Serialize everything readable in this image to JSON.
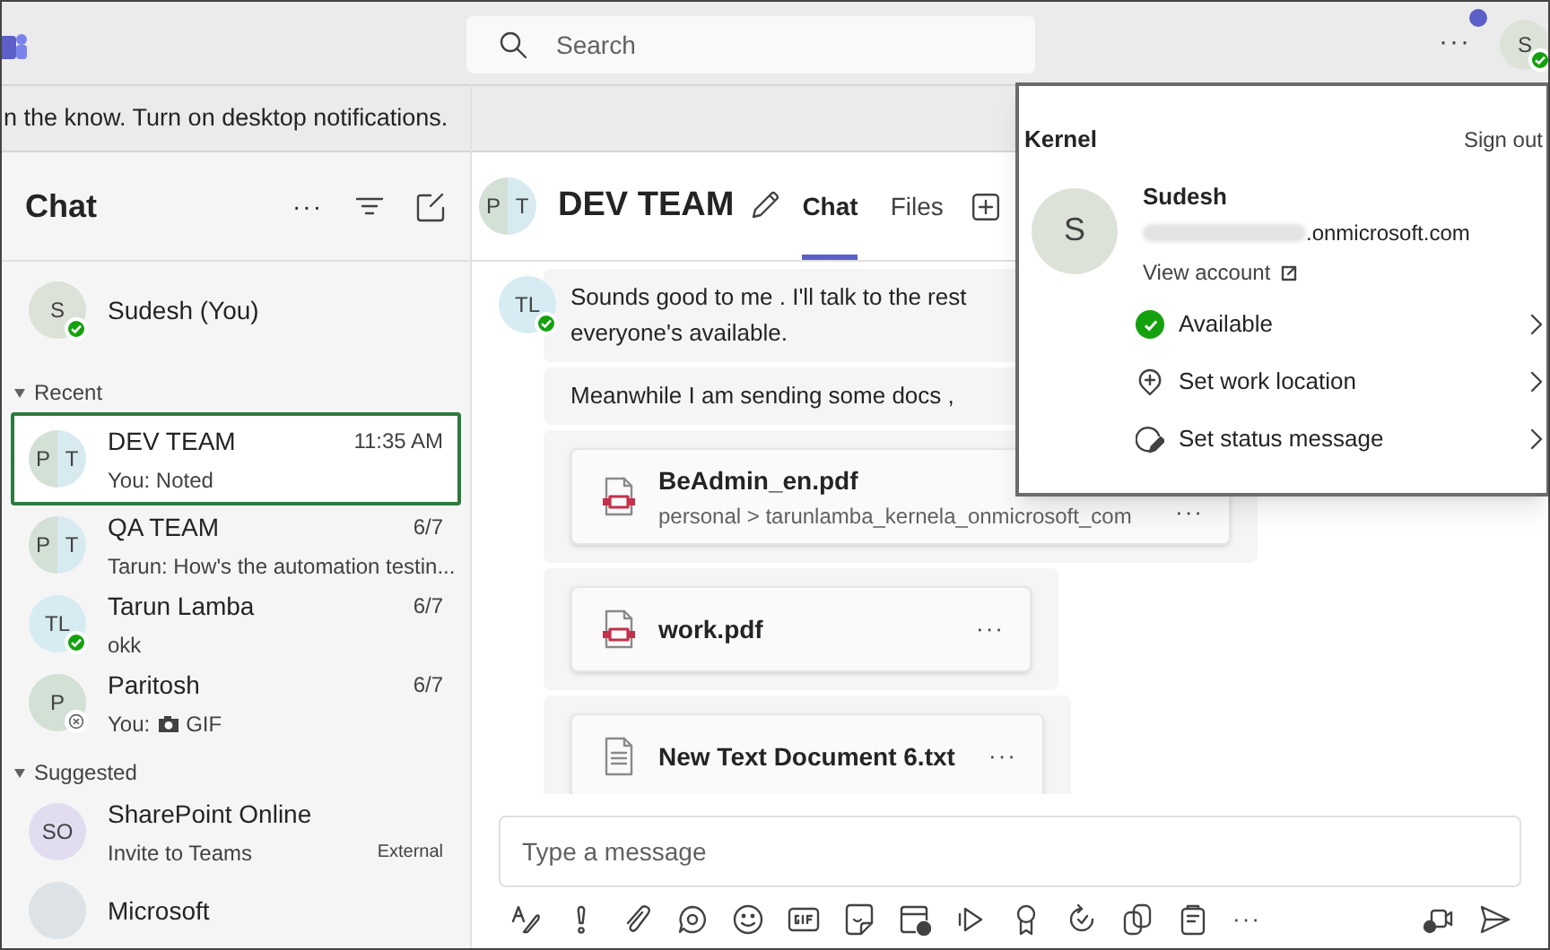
{
  "top_bar": {
    "search": {
      "placeholder": "Search"
    },
    "more": "···",
    "account": {
      "initials": "S",
      "available": true,
      "notification": true
    }
  },
  "banner": {
    "text": "n the know. Turn on desktop notifications."
  },
  "sidebar": {
    "title": "Chat",
    "more": "···",
    "self": {
      "avatar": [
        "S"
      ],
      "name": "Sudesh (You)",
      "available": true
    },
    "sections": [
      {
        "label": "Recent",
        "expanded": true,
        "items": [
          {
            "avatar": [
              "P",
              "T"
            ],
            "name": "DEV TEAM",
            "time": "11:35 AM",
            "preview": "You: Noted",
            "selected": true
          },
          {
            "avatar": [
              "P",
              "T"
            ],
            "name": "QA TEAM",
            "time": "6/7",
            "preview": "Tarun: How's the automation testin...",
            "selected": false
          },
          {
            "avatar": [
              "TL"
            ],
            "available": true,
            "name": "Tarun Lamba",
            "time": "6/7",
            "preview": "okk",
            "selected": false
          },
          {
            "avatar": [
              "P"
            ],
            "available": false,
            "name": "Paritosh",
            "time": "6/7",
            "preview": "You:",
            "attachment": "GIF",
            "selected": false
          }
        ]
      },
      {
        "label": "Suggested",
        "expanded": true,
        "items": [
          {
            "avatar": [
              "SO"
            ],
            "name": "SharePoint Online",
            "preview": "Invite to Teams",
            "badge": "External",
            "selected": false
          },
          {
            "name": "Microsoft",
            "selected": false
          }
        ]
      }
    ]
  },
  "chat": {
    "avatar": [
      "P",
      "T"
    ],
    "title": "DEV TEAM",
    "tabs": [
      {
        "label": "Chat",
        "selected": true
      },
      {
        "label": "Files",
        "selected": false
      }
    ],
    "messages": [
      {
        "kind": "text",
        "avatar": [
          "TL"
        ],
        "available": true,
        "lines": [
          "Sounds good to me . I'll talk to the rest",
          "everyone's available."
        ]
      },
      {
        "kind": "text",
        "lines": [
          "Meanwhile I am sending some docs ,"
        ]
      },
      {
        "kind": "pdf",
        "name": "BeAdmin_en.pdf",
        "path": "personal > tarunlamba_kernela_onmicrosoft_com",
        "menu": "···"
      },
      {
        "kind": "pdf",
        "name": "work.pdf",
        "menu": "···"
      },
      {
        "kind": "document",
        "name": "New Text Document 6.txt",
        "menu": "···"
      }
    ],
    "composer": {
      "placeholder": "Type a message",
      "more": "···"
    }
  },
  "profile_menu": {
    "org": "Kernel",
    "sign_out": "Sign out",
    "avatar": "S",
    "name": "Sudesh",
    "email": ".onmicrosoft.com",
    "view_account": "View account",
    "options": [
      {
        "kind": "presence",
        "label": "Available"
      },
      {
        "kind": "location",
        "label": "Set work location"
      },
      {
        "kind": "status",
        "label": "Set status message"
      }
    ]
  }
}
